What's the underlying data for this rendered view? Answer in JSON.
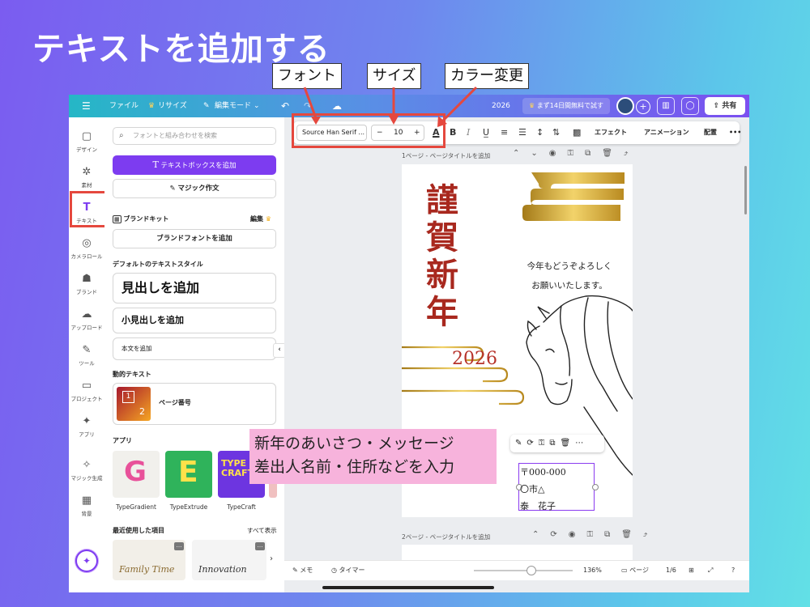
{
  "slide": {
    "title": "テキストを追加する",
    "callouts": {
      "font": "フォント",
      "size": "サイズ",
      "color": "カラー変更"
    },
    "annotation_lines": [
      "新年のあいさつ・メッセージ",
      "差出人名前・住所などを入力"
    ]
  },
  "topbar": {
    "menu_icon": "☰",
    "file": "ファイル",
    "resize": "リサイズ",
    "edit_mode": "編集モード",
    "year_label": "2026",
    "trial": "まず14日間無料で試す",
    "share": "共有"
  },
  "rail": {
    "items": [
      {
        "icon": "▢",
        "label": "デザイン"
      },
      {
        "icon": "✲",
        "label": "素材"
      },
      {
        "icon": "T",
        "label": "テキスト"
      },
      {
        "icon": "◎",
        "label": "カメラロール"
      },
      {
        "icon": "☗",
        "label": "ブランド"
      },
      {
        "icon": "☁",
        "label": "アップロード"
      },
      {
        "icon": "✎",
        "label": "ツール"
      },
      {
        "icon": "▭",
        "label": "プロジェクト"
      },
      {
        "icon": "✦",
        "label": "アプリ"
      },
      {
        "icon": "✧",
        "label": "マジック生成"
      },
      {
        "icon": "▦",
        "label": "背景"
      }
    ]
  },
  "panel": {
    "search_placeholder": "フォントと組み合わせを検索",
    "add_textbox": "テキストボックスを追加",
    "magic_write": "マジック作文",
    "brand_kit": "ブランドキット",
    "edit": "編集",
    "add_brand_fonts": "ブランドフォントを追加",
    "default_styles": "デフォルトのテキストスタイル",
    "heading": "見出しを追加",
    "subheading": "小見出しを追加",
    "body": "本文を追加",
    "dynamic_text": "動的テキスト",
    "page_number": "ページ番号",
    "page_tile_numbers": [
      "1",
      "2"
    ],
    "apps": "アプリ",
    "app_list": [
      "TypeGradient",
      "TypeExtrude",
      "TypeCraft"
    ],
    "app_letters": [
      "G",
      "E",
      "TYPE CRAFT"
    ],
    "recent": "最近使用した項目",
    "see_all": "すべて表示",
    "recent_items": [
      "Family Time",
      "Innovation"
    ]
  },
  "text_toolbar": {
    "font": "Source Han Serif ...",
    "size": "10",
    "minus": "−",
    "plus": "+",
    "color_letter": "A",
    "bold": "B",
    "italic": "I",
    "effects": "エフェクト",
    "animation": "アニメーション",
    "position": "配置",
    "more": "•••"
  },
  "pages": {
    "page1_label": "1ページ - ページタイトルを追加",
    "page2_label": "2ページ - ページタイトルを追加"
  },
  "card": {
    "kanji": [
      "謹",
      "賀",
      "新",
      "年"
    ],
    "greeting": [
      "今年もどうぞよろしく",
      "お願いいたします。"
    ],
    "year": "2026",
    "address": [
      "〒000-000",
      "〇市△",
      "泰　花子"
    ]
  },
  "bottombar": {
    "notes": "メモ",
    "timer": "タイマー",
    "zoom": "136%",
    "zoom_fraction": 0.58,
    "pages": "ページ",
    "page_count": "1/6",
    "help": "?"
  },
  "colors": {
    "accent": "#7d3cf0",
    "callout_red": "#e5483e",
    "kanji_red": "#a8281e",
    "annotation_pink": "#f7b3dc",
    "gold": "#c9a227"
  }
}
